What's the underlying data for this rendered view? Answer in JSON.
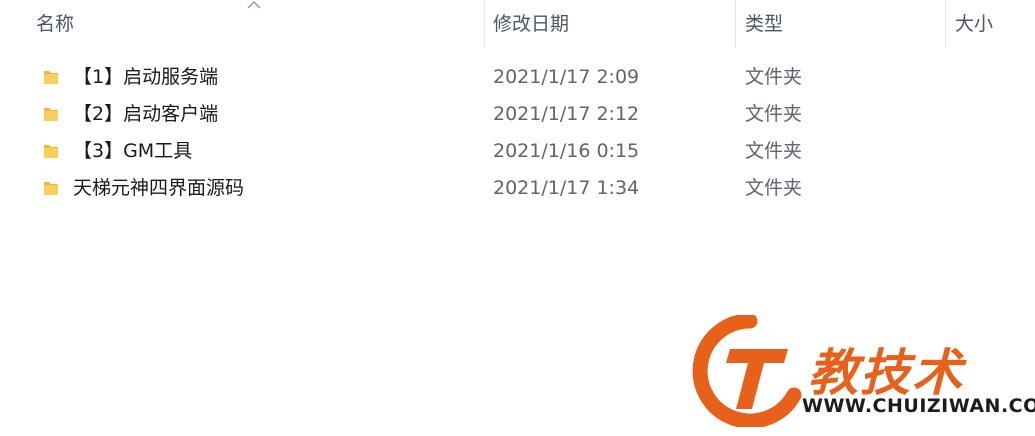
{
  "columns": {
    "name": "名称",
    "date": "修改日期",
    "type": "类型",
    "size": "大小"
  },
  "files": [
    {
      "name": "【1】启动服务端",
      "date": "2021/1/17 2:09",
      "type": "文件夹"
    },
    {
      "name": "【2】启动客户端",
      "date": "2021/1/17 2:12",
      "type": "文件夹"
    },
    {
      "name": "【3】GM工具",
      "date": "2021/1/16 0:15",
      "type": "文件夹"
    },
    {
      "name": "天梯元神四界面源码",
      "date": "2021/1/17 1:34",
      "type": "文件夹"
    }
  ],
  "watermark": {
    "text": "教技术",
    "url": "WWW.CHUIZIWAN.COM"
  },
  "colors": {
    "brand_orange": "#e8611b",
    "folder_yellow": "#f4c94f"
  },
  "icons": {
    "folder": "folder-icon",
    "sort": "sort-ascending-icon"
  }
}
